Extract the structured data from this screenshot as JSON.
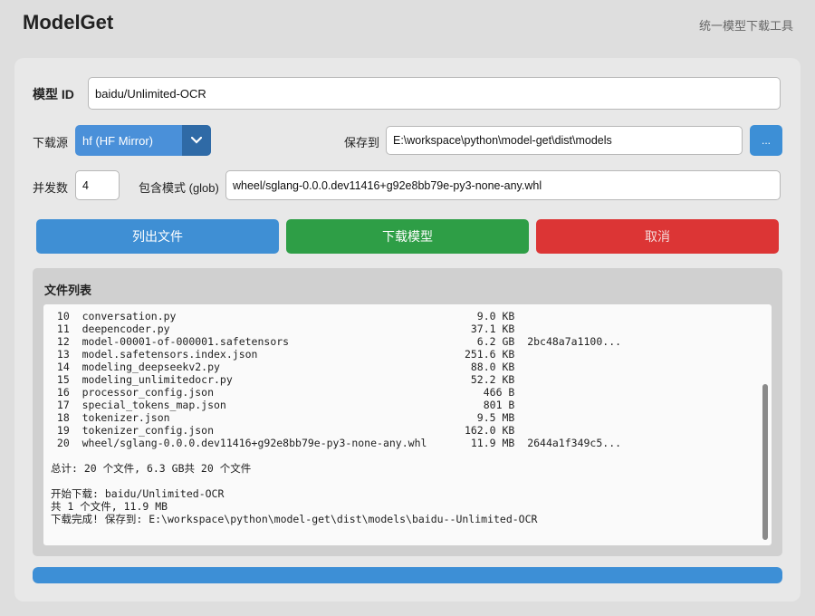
{
  "header": {
    "title": "ModelGet",
    "subtitle": "统一模型下载工具"
  },
  "form": {
    "model_id_label": "模型 ID",
    "model_id_value": "baidu/Unlimited-OCR",
    "source_label": "下载源",
    "source_value": "hf (HF Mirror)",
    "save_label": "保存到",
    "save_value": "E:\\workspace\\python\\model-get\\dist\\models",
    "browse_label": "...",
    "concurrency_label": "并发数",
    "concurrency_value": "4",
    "glob_label": "包含模式 (glob)",
    "glob_value": "wheel/sglang-0.0.0.dev11416+g92e8bb79e-py3-none-any.whl"
  },
  "actions": {
    "list_label": "列出文件",
    "download_label": "下载模型",
    "cancel_label": "取消"
  },
  "files": {
    "title": "文件列表",
    "rows": [
      {
        "idx": "10",
        "name": "conversation.py",
        "size": "9.0 KB",
        "hash": ""
      },
      {
        "idx": "11",
        "name": "deepencoder.py",
        "size": "37.1 KB",
        "hash": ""
      },
      {
        "idx": "12",
        "name": "model-00001-of-000001.safetensors",
        "size": "6.2 GB",
        "hash": "2bc48a7a1100..."
      },
      {
        "idx": "13",
        "name": "model.safetensors.index.json",
        "size": "251.6 KB",
        "hash": ""
      },
      {
        "idx": "14",
        "name": "modeling_deepseekv2.py",
        "size": "88.0 KB",
        "hash": ""
      },
      {
        "idx": "15",
        "name": "modeling_unlimitedocr.py",
        "size": "52.2 KB",
        "hash": ""
      },
      {
        "idx": "16",
        "name": "processor_config.json",
        "size": "466 B",
        "hash": ""
      },
      {
        "idx": "17",
        "name": "special_tokens_map.json",
        "size": "801 B",
        "hash": ""
      },
      {
        "idx": "18",
        "name": "tokenizer.json",
        "size": "9.5 MB",
        "hash": ""
      },
      {
        "idx": "19",
        "name": "tokenizer_config.json",
        "size": "162.0 KB",
        "hash": ""
      },
      {
        "idx": "20",
        "name": "wheel/sglang-0.0.0.dev11416+g92e8bb79e-py3-none-any.whl",
        "size": "11.9 MB",
        "hash": "2644a1f349c5..."
      }
    ],
    "summary": "总计: 20 个文件, 6.3 GB共 20 个文件",
    "log_lines": [
      "开始下载: baidu/Unlimited-OCR",
      "共 1 个文件, 11.9 MB",
      "下载完成! 保存到: E:\\workspace\\python\\model-get\\dist\\models\\baidu--Unlimited-OCR"
    ]
  },
  "progress": {
    "percent": 100,
    "color": "#3d8fd6"
  }
}
